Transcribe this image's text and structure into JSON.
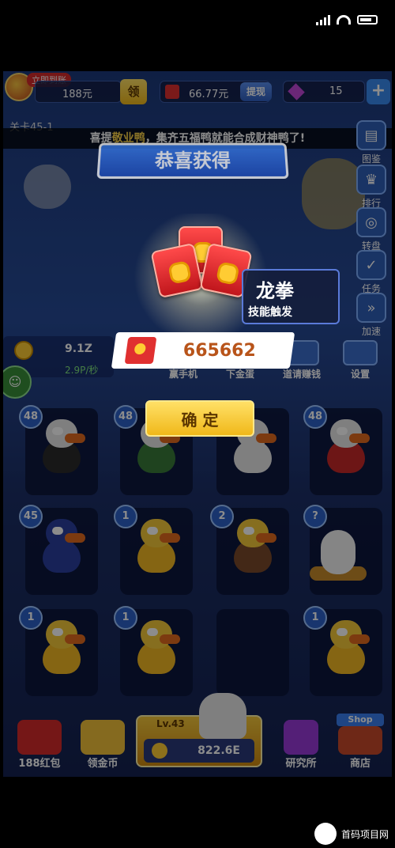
{
  "statusbar": {
    "time": ""
  },
  "topbar": {
    "daily_badge": "立即到账",
    "cash": "188元",
    "claim_label": "领",
    "balance": "66.77元",
    "withdraw_label": "提现",
    "gems": "15",
    "add_label": "+"
  },
  "level": {
    "label": "关卡45-1"
  },
  "notice": {
    "prefix": "喜提",
    "highlight": "敬业鸭",
    "suffix": "，集齐五福鸭就能合成财神鸭了!"
  },
  "side_menu": [
    {
      "label": "图鉴",
      "icon": "book-icon"
    },
    {
      "label": "排行",
      "icon": "trophy-icon"
    },
    {
      "label": "转盘",
      "icon": "wheel-icon"
    },
    {
      "label": "任务",
      "icon": "checklist-icon"
    },
    {
      "label": "加速",
      "icon": "speed-icon"
    }
  ],
  "dialog": {
    "title": "恭喜获得",
    "reward_value": "665662",
    "confirm_label": "确 定",
    "skill_text": "龙拳",
    "skill_sub": "技能触发"
  },
  "economy": {
    "coins": "9.1Z",
    "rate": "2.9P/秒"
  },
  "tools": [
    {
      "label": "赢手机"
    },
    {
      "label": "下金蛋"
    },
    {
      "label": "道请赚钱"
    },
    {
      "label": "设置"
    }
  ],
  "slots": [
    {
      "level": "48",
      "type": "white dark"
    },
    {
      "level": "48",
      "type": "white green"
    },
    {
      "level": "",
      "type": "white"
    },
    {
      "level": "48",
      "type": "white"
    },
    {
      "level": "45",
      "type": "blue"
    },
    {
      "level": "1",
      "type": ""
    },
    {
      "level": "2",
      "type": "brown"
    },
    {
      "level": "?",
      "type": "egg"
    },
    {
      "level": "1",
      "type": ""
    },
    {
      "level": "1",
      "type": ""
    },
    {
      "level": "",
      "type": "empty"
    },
    {
      "level": "1",
      "type": ""
    }
  ],
  "bottom": {
    "red_packet_label": "188红包",
    "coins_label": "领金币",
    "duck_level": "Lv.43",
    "buy_value": "822.6E",
    "research_label": "研究所",
    "shop_sign": "Shop",
    "shop_label": "商店"
  },
  "watermark": {
    "text": "首码项目网"
  }
}
